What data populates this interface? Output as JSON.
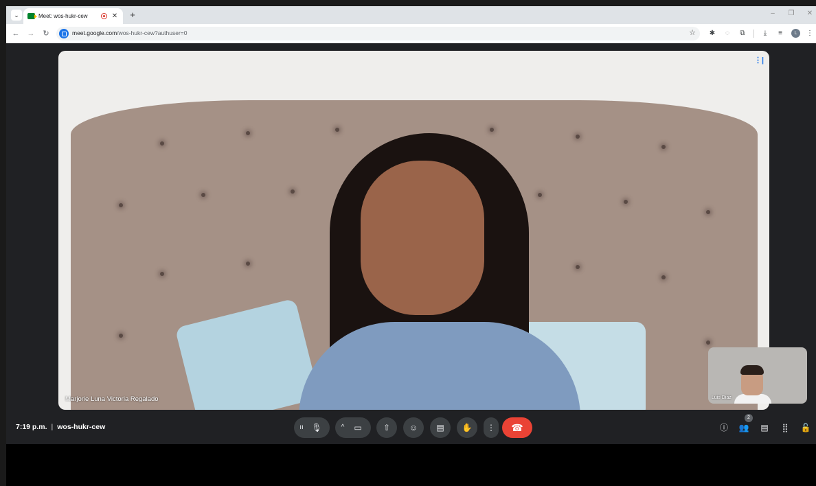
{
  "browser": {
    "tab_title": "Meet: wos-hukr-cew",
    "url_host": "meet.google.com",
    "url_path": "/wos-hukr-cew?authuser=0",
    "tab_close": "✕",
    "new_tab": "+",
    "profile_initial": "L"
  },
  "meeting": {
    "time": "7:19 p.m.",
    "separator": "|",
    "code": "wos-hukr-cew",
    "main_participant": "Marjorie Luna Victoria Regalado",
    "self_participant": "Luis Diaz",
    "people_count": "2"
  }
}
